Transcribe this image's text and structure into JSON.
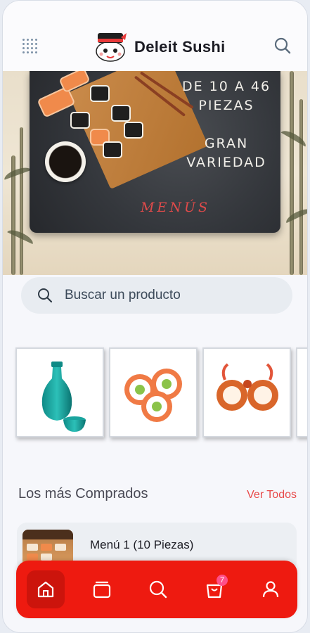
{
  "header": {
    "brand": "Deleit Sushi",
    "menu_icon": "grid-dots-icon",
    "logo_icon": "sushi-mascot-icon",
    "search_icon": "search-icon"
  },
  "banner": {
    "line1": "DE 10 A 46",
    "line2": "PIEZAS",
    "line3": "GRAN",
    "line4": "VARIEDAD",
    "menus": "MENÚS"
  },
  "search": {
    "placeholder": "Buscar un producto",
    "icon": "search-icon"
  },
  "categories": [
    {
      "name": "sake-bottle"
    },
    {
      "name": "salmon-rolls"
    },
    {
      "name": "shrimp-rolls"
    }
  ],
  "section": {
    "title": "Los más Comprados",
    "link": "Ver Todos"
  },
  "items": [
    {
      "name": "Menú 1 (10 Piezas)"
    }
  ],
  "nav": {
    "items": [
      "home-icon",
      "catalog-icon",
      "search-icon",
      "cart-icon",
      "user-icon"
    ],
    "active": "home-icon",
    "cart_count": "7"
  },
  "colors": {
    "accent": "#ee1a10",
    "link": "#e84a4a",
    "badge": "#ff4f8a"
  }
}
